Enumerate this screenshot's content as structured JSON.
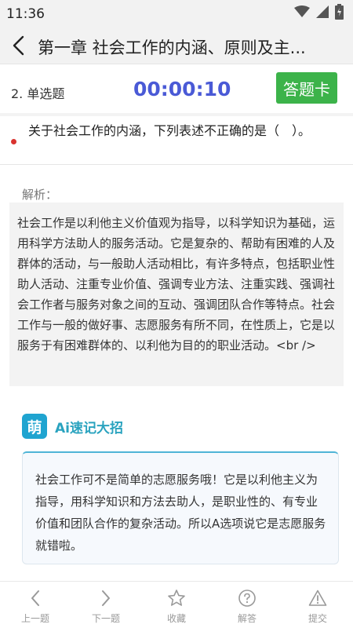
{
  "status_bar": {
    "time": "11:36",
    "icons": [
      "wifi-icon",
      "signal-icon",
      "battery-icon"
    ]
  },
  "nav": {
    "title": "第一章 社会工作的内涵、原则及主...",
    "back_icon": "chevron-left-icon"
  },
  "question_header": {
    "type": "2. 单选题",
    "timer": "00:00:10",
    "answer_card_label": "答题卡"
  },
  "question": {
    "text": "关于社会工作的内涵，下列表述不正确的是（　）。"
  },
  "analysis": {
    "label": "解析：",
    "text": "社会工作是以利他主义价值观为指导，以科学知识为基础，运用科学方法助人的服务活动。它是复杂的、帮助有困难的人及群体的活动，与一般助人活动相比，有许多特点，包括职业性助人活动、注重专业价值、强调专业方法、注重实践、强调社会工作者与服务对象之间的互动、强调团队合作等特点。社会工作与一般的做好事、志愿服务有所不同，在性质上，它是以服务于有困难群体的、以利他为目的的职业活动。<br />"
  },
  "ai": {
    "badge": "萌",
    "title": "Ai速记大招",
    "text": "社会工作可不是简单的志愿服务哦！它是以利他主义为指导，用科学知识和方法去助人，是职业性的、有专业价值和团队合作的复杂活动。所以A选项说它是志愿服务就错啦。"
  },
  "bottom_tabs": [
    {
      "label": "上一题",
      "icon": "chevron-left-icon"
    },
    {
      "label": "下一题",
      "icon": "chevron-right-icon"
    },
    {
      "label": "收藏",
      "icon": "star-icon"
    },
    {
      "label": "解答",
      "icon": "question-circle-icon"
    },
    {
      "label": "提交",
      "icon": "warning-icon"
    }
  ],
  "colors": {
    "timer": "#4a5ad6",
    "answer_card": "#3cb34a",
    "ai_accent": "#2aa3bf",
    "dot": "#d9332f"
  }
}
